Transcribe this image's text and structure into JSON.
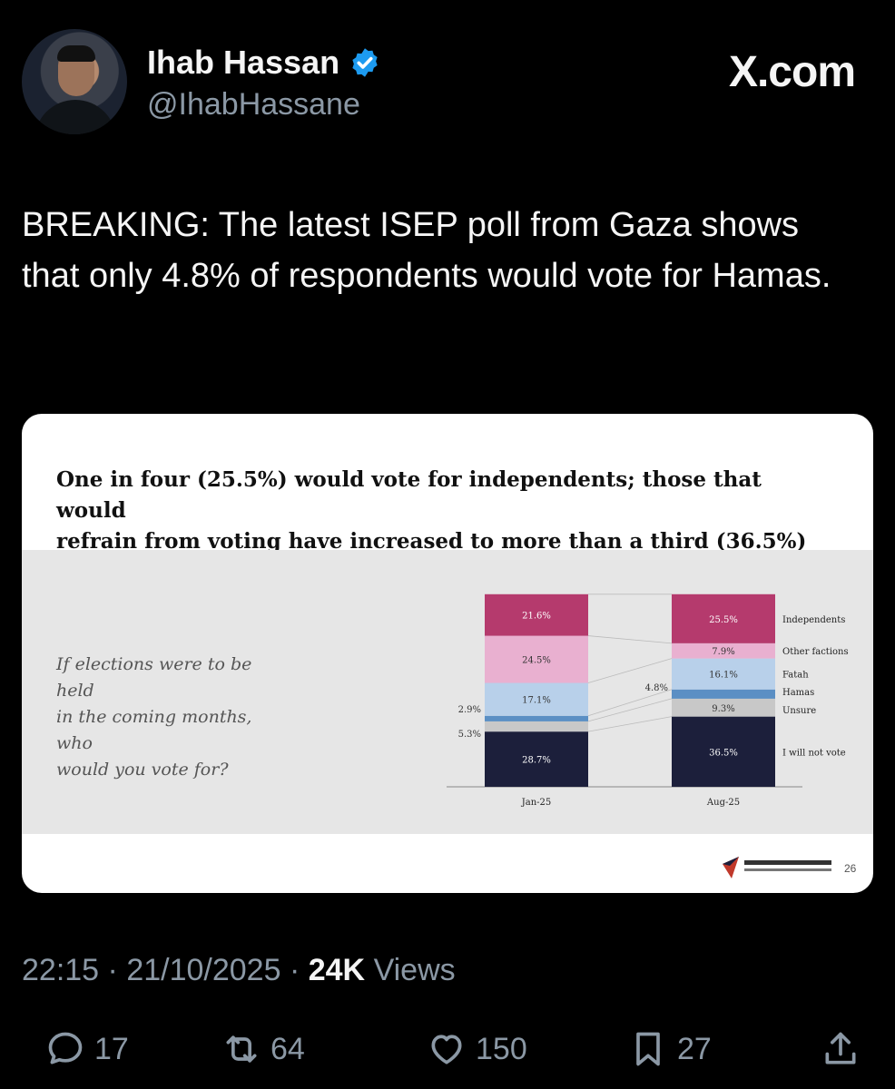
{
  "author": {
    "name": "Ihab Hassan",
    "handle": "@IhabHassane"
  },
  "brand": "X.com",
  "tweet": {
    "text": "BREAKING: The latest ISEP poll from Gaza shows that only 4.8% of respondents would vote for Hamas."
  },
  "card": {
    "title_line1": "One in four (25.5%) would vote for independents; those that would",
    "title_line2": "refrain from voting have increased to more than a third (36.5%)",
    "question_line1": "If elections were to be held",
    "question_line2": "in the coming months, who",
    "question_line3": "would you vote for?",
    "page_number": "26"
  },
  "chart_data": {
    "type": "bar",
    "stacked": true,
    "categories": [
      "Jan-25",
      "Aug-25"
    ],
    "series": [
      {
        "name": "I will not vote",
        "values": [
          28.7,
          36.5
        ],
        "color": "#1c1f3b"
      },
      {
        "name": "Unsure",
        "values": [
          5.3,
          9.3
        ],
        "color": "#c8c8c8"
      },
      {
        "name": "Hamas",
        "values": [
          2.9,
          4.8
        ],
        "color": "#5b8fc4"
      },
      {
        "name": "Fatah",
        "values": [
          17.1,
          16.1
        ],
        "color": "#b8d0ea"
      },
      {
        "name": "Other factions",
        "values": [
          24.5,
          7.9
        ],
        "color": "#e9b0d0"
      },
      {
        "name": "Independents",
        "values": [
          21.6,
          25.5
        ],
        "color": "#b53a6d"
      }
    ],
    "value_labels": {
      "I will not vote": [
        "28.7%",
        "36.5%"
      ],
      "Unsure": [
        "5.3%",
        "9.3%"
      ],
      "Hamas": [
        "2.9%",
        "4.8%"
      ],
      "Fatah": [
        "17.1%",
        "16.1%"
      ],
      "Other factions": [
        "24.5%",
        "7.9%"
      ],
      "Independents": [
        "21.6%",
        "25.5%"
      ]
    },
    "title": "",
    "xlabel": "",
    "ylabel": "",
    "ylim": [
      0,
      100
    ]
  },
  "footer": {
    "time": "22:15",
    "date": "21/10/2025",
    "views_count": "24K",
    "views_label": "Views"
  },
  "actions": {
    "replies": "17",
    "reposts": "64",
    "likes": "150",
    "bookmarks": "27"
  },
  "icons": {
    "verified": "verified-badge-icon",
    "reply": "reply-icon",
    "repost": "repost-icon",
    "like": "heart-icon",
    "bookmark": "bookmark-icon",
    "share": "share-icon"
  },
  "colors": {
    "verified_blue": "#1d9bf0",
    "secondary_text": "#8b98a5"
  }
}
